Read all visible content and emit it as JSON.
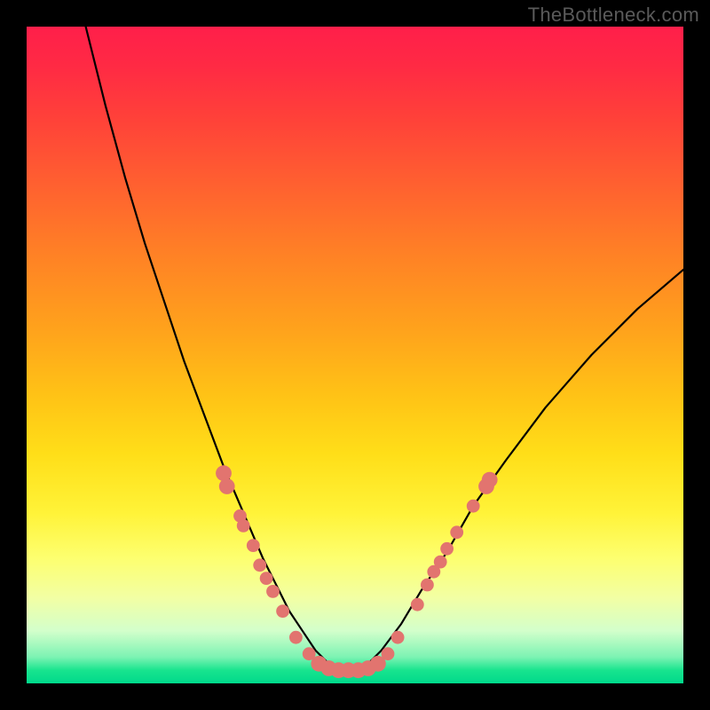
{
  "watermark": "TheBottleneck.com",
  "chart_data": {
    "type": "line",
    "title": "",
    "xlabel": "",
    "ylabel": "",
    "xlim": [
      0,
      100
    ],
    "ylim": [
      0,
      100
    ],
    "series": [
      {
        "name": "curve",
        "x": [
          9,
          12,
          15,
          18,
          21,
          24,
          27,
          30,
          33,
          36,
          38,
          40,
          42,
          44,
          46,
          48,
          50,
          52,
          54,
          57,
          60,
          64,
          68,
          73,
          79,
          86,
          93,
          100
        ],
        "y": [
          100,
          88,
          77,
          67,
          58,
          49,
          41,
          33,
          26,
          19,
          15,
          11,
          8,
          5,
          3,
          2,
          2,
          3,
          5,
          9,
          14,
          20,
          27,
          34,
          42,
          50,
          57,
          63
        ]
      }
    ],
    "markers": [
      {
        "x": 30.0,
        "y": 32.0,
        "r": 1.2
      },
      {
        "x": 30.5,
        "y": 30.0,
        "r": 1.2
      },
      {
        "x": 32.5,
        "y": 25.5,
        "r": 1.0
      },
      {
        "x": 33.0,
        "y": 24.0,
        "r": 1.0
      },
      {
        "x": 34.5,
        "y": 21.0,
        "r": 1.0
      },
      {
        "x": 35.5,
        "y": 18.0,
        "r": 1.0
      },
      {
        "x": 36.5,
        "y": 16.0,
        "r": 1.0
      },
      {
        "x": 37.5,
        "y": 14.0,
        "r": 1.0
      },
      {
        "x": 39.0,
        "y": 11.0,
        "r": 1.0
      },
      {
        "x": 41.0,
        "y": 7.0,
        "r": 1.0
      },
      {
        "x": 43.0,
        "y": 4.5,
        "r": 1.0
      },
      {
        "x": 44.5,
        "y": 3.0,
        "r": 1.2
      },
      {
        "x": 46.0,
        "y": 2.3,
        "r": 1.2
      },
      {
        "x": 47.5,
        "y": 2.0,
        "r": 1.2
      },
      {
        "x": 49.0,
        "y": 2.0,
        "r": 1.2
      },
      {
        "x": 50.5,
        "y": 2.0,
        "r": 1.2
      },
      {
        "x": 52.0,
        "y": 2.3,
        "r": 1.2
      },
      {
        "x": 53.5,
        "y": 3.0,
        "r": 1.2
      },
      {
        "x": 55.0,
        "y": 4.5,
        "r": 1.0
      },
      {
        "x": 56.5,
        "y": 7.0,
        "r": 1.0
      },
      {
        "x": 59.5,
        "y": 12.0,
        "r": 1.0
      },
      {
        "x": 61.0,
        "y": 15.0,
        "r": 1.0
      },
      {
        "x": 62.0,
        "y": 17.0,
        "r": 1.0
      },
      {
        "x": 63.0,
        "y": 18.5,
        "r": 1.0
      },
      {
        "x": 64.0,
        "y": 20.5,
        "r": 1.0
      },
      {
        "x": 65.5,
        "y": 23.0,
        "r": 1.0
      },
      {
        "x": 68.0,
        "y": 27.0,
        "r": 1.0
      },
      {
        "x": 70.0,
        "y": 30.0,
        "r": 1.2
      },
      {
        "x": 70.5,
        "y": 31.0,
        "r": 1.2
      }
    ],
    "colors": {
      "curve_stroke": "#000000",
      "marker_fill": "#e2746f",
      "gradient_top": "#ff1f4a",
      "gradient_bottom": "#00d98b"
    }
  }
}
